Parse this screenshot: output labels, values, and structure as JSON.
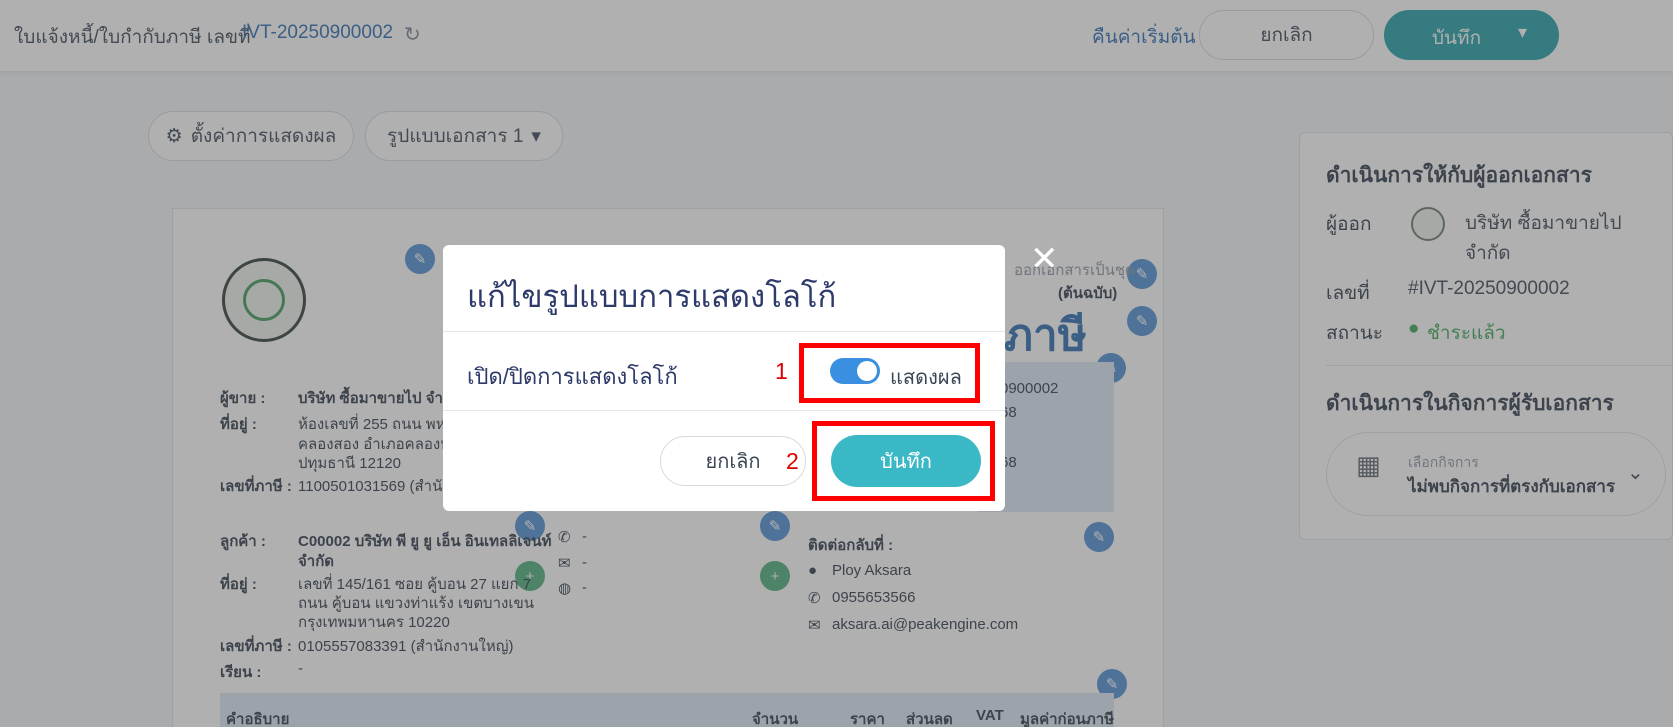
{
  "topbar": {
    "title": "ใบแจ้งหนี้/ใบกำกับภาษี เลขที่",
    "doc_no": "IVT-20250900002",
    "refresh_icon": "↻",
    "reset_label": "คืนค่าเริ่มต้น",
    "cancel_label": "ยกเลิก",
    "save_label": "บันทึก",
    "chevron": "⌄"
  },
  "toolbar": {
    "display_settings": "ตั้งค่าการแสดงผล",
    "gear_icon": "⚙",
    "template_select": "รูปแบบเอกสาร 1",
    "chevron": "⌄"
  },
  "document": {
    "header_right_line1": "ออกเอกสารเป็นชุด",
    "header_right_line2": "(ต้นฉบับ)",
    "big_title_fragment": "ภาษี",
    "seller_label": "ผู้ขาย :",
    "seller_value": "บริษัท ซื้อมาขายไป จำกัด",
    "address_label": "ที่อยู่ :",
    "address_l1": "ห้องเลขที่ 255 ถนน พหล",
    "address_l2": "คลองสอง อำเภอคลองห",
    "address_l3": "ปทุมธานี 12120",
    "taxid_label": "เลขที่ภาษี :",
    "taxid_value": "1100501031569 (สำนัก",
    "docno_fragment": "0900002",
    "num_fragment_1": "68",
    "num_fragment_2": "68",
    "customer_label": "ลูกค้า :",
    "customer_value_l1": "C00002 บริษัท พี ยู ยู เอ็น อินเทลลิเจนท์",
    "customer_value_l2": "จำกัด",
    "cust_addr_label": "ที่อยู่ :",
    "cust_addr_l1": "เลขที่ 145/161    ซอย คู้บอน 27 แยก 7",
    "cust_addr_l2": "ถนน คู้บอน  แขวงท่าแร้ง เขตบางเขน",
    "cust_addr_l3": "กรุงเทพมหานคร 10220",
    "cust_tax_label": "เลขที่ภาษี :",
    "cust_tax_value": "0105557083391 (สำนักงานใหญ่)",
    "attn_label": "เรียน :",
    "attn_value": "-",
    "phone_dash": "-",
    "email_dash": "-",
    "web_dash": "-",
    "contact_label": "ติดต่อกลับที่ :",
    "contact_name": "Ploy Aksara",
    "contact_phone": "0955653566",
    "contact_email": "aksara.ai@peakengine.com",
    "table_headers": [
      "คำอธิบาย",
      "จำนวน",
      "ราคา",
      "ส่วนลด",
      "VAT",
      "มูลค่าก่อนภาษี"
    ]
  },
  "right_panel": {
    "issuer_section_title": "ดำเนินการให้กับผู้ออกเอกสาร",
    "issuer_label": "ผู้ออก",
    "issuer_value_l1": "บริษัท ซื้อมาขายไป",
    "issuer_value_l2": "จำกัด",
    "number_label": "เลขที่",
    "number_value": "#IVT-20250900002",
    "status_label": "สถานะ",
    "status_value": "ชำระแล้ว",
    "status_color": "#3aa757",
    "receiver_section_title": "ดำเนินการในกิจการผู้รับเอกสาร",
    "business_select_caption": "เลือกกิจการ",
    "business_select_value": "ไม่พบกิจการที่ตรงกับเอกสาร"
  },
  "modal": {
    "title": "แก้ไขรูปแบบการแสดงโลโก้",
    "toggle_row_label": "เปิด/ปิดการแสดงโลโก้",
    "toggle_state_label": "แสดงผล",
    "toggle_on": true,
    "cancel_label": "ยกเลิก",
    "save_label": "บันทึก",
    "close_icon": "✕"
  },
  "annotations": {
    "step1": "1",
    "step2": "2"
  },
  "colors": {
    "primary": "#1f9fa8",
    "modal_save": "#3bb8c6",
    "toggle": "#3a8fe0",
    "annotation_red": "#ff0000"
  }
}
